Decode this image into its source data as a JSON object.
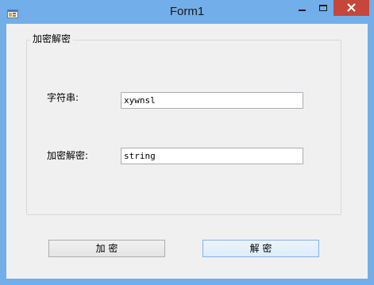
{
  "window": {
    "title": "Form1",
    "icon": "windows-form-icon",
    "controls": {
      "minimize": "minimize-icon",
      "maximize": "maximize-icon",
      "close": "close-icon"
    },
    "close_color": "#c7463c",
    "frame_color": "#72aee9"
  },
  "group": {
    "title": "加密解密"
  },
  "fields": {
    "string_label": "字符串:",
    "string_value": "xywnsl",
    "crypto_label": "加密解密:",
    "crypto_value": "string"
  },
  "buttons": {
    "encrypt": "加 密",
    "decrypt": "解 密"
  }
}
